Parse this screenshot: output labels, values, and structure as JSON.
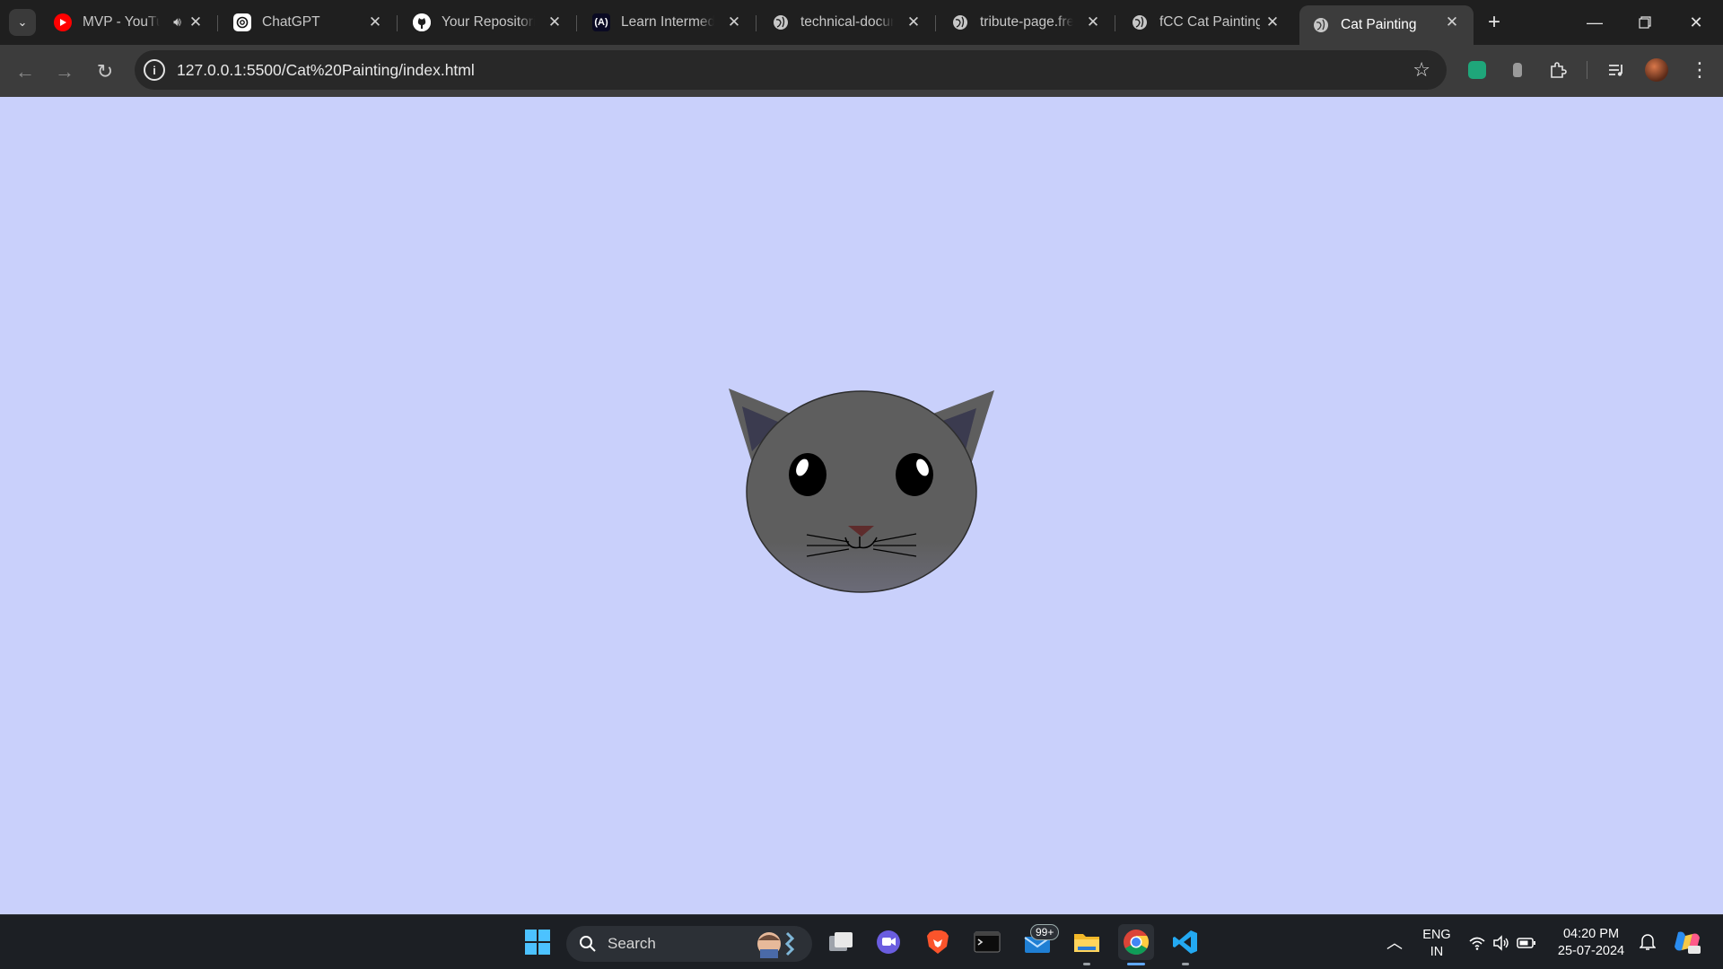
{
  "browser": {
    "tabs": [
      {
        "title": "MVP - YouTube",
        "favicon": "youtube-icon",
        "audio": true
      },
      {
        "title": "ChatGPT",
        "favicon": "chatgpt-icon"
      },
      {
        "title": "Your Repositories",
        "favicon": "github-icon"
      },
      {
        "title": "Learn Intermediate",
        "favicon": "freecodecamp-icon"
      },
      {
        "title": "technical-documentation",
        "favicon": "globe-icon"
      },
      {
        "title": "tribute-page.freecodecamp",
        "favicon": "globe-icon"
      },
      {
        "title": "fCC Cat Painting",
        "favicon": "globe-icon"
      },
      {
        "title": "Cat Painting",
        "favicon": "globe-icon",
        "active": true
      }
    ],
    "address_bar": {
      "url": "127.0.0.1:5500/Cat%20Painting/index.html"
    },
    "page_background": "#c9d0fb"
  },
  "page": {
    "cat": {
      "fur_color": "#5e5e5e",
      "inner_ear_color": "#3b3b4f",
      "nose_color": "#5e2c2c"
    }
  },
  "taskbar": {
    "search_label": "Search",
    "mail_badge": "99+",
    "language_line1": "ENG",
    "language_line2": "IN",
    "time": "04:20 PM",
    "date": "25-07-2024"
  }
}
